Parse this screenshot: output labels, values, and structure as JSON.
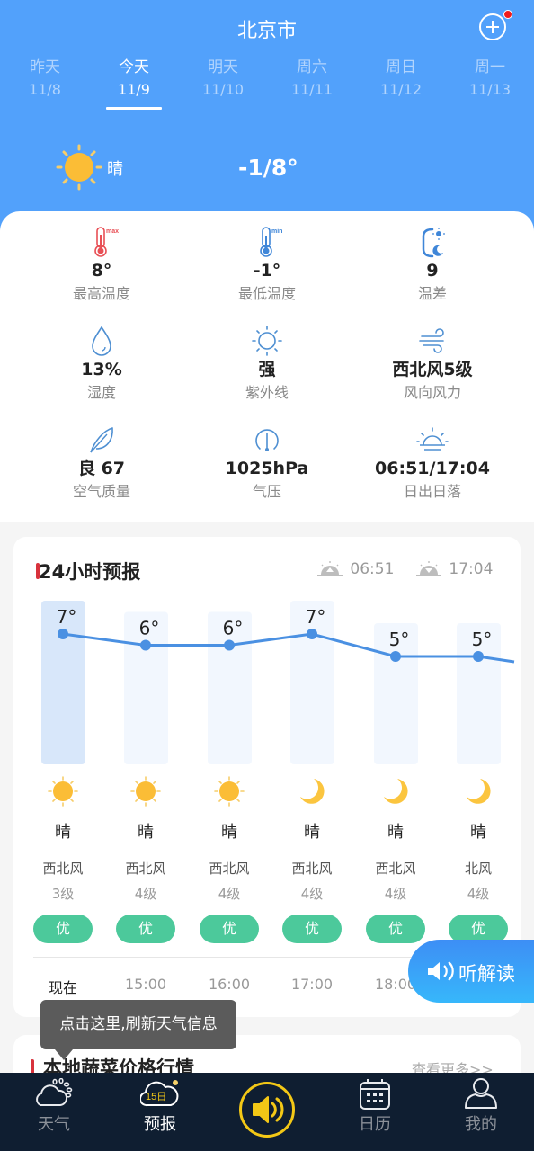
{
  "header": {
    "city": "北京市",
    "add_city_icon": "plus-circle-icon",
    "notification_dot": true,
    "colors": {
      "header_bg": "#52a1fb",
      "accent_red": "#d8323c",
      "aqi_good": "#4cc99b",
      "tabbar_bg": "#0f1e31",
      "tab_center": "#f3c816"
    }
  },
  "days": [
    {
      "name": "昨天",
      "date": "11/8",
      "active": false
    },
    {
      "name": "今天",
      "date": "11/9",
      "active": true
    },
    {
      "name": "明天",
      "date": "11/10",
      "active": false
    },
    {
      "name": "周六",
      "date": "11/11",
      "active": false
    },
    {
      "name": "周日",
      "date": "11/12",
      "active": false
    },
    {
      "name": "周一",
      "date": "11/13",
      "active": false
    }
  ],
  "current": {
    "icon": "sun-icon",
    "condition": "晴",
    "temp_range": "-1/8°"
  },
  "details": [
    {
      "icon": "thermometer-max-icon",
      "value": "8°",
      "label": "最高温度"
    },
    {
      "icon": "thermometer-min-icon",
      "value": "-1°",
      "label": "最低温度"
    },
    {
      "icon": "temp-diff-icon",
      "value": "9",
      "label": "温差"
    },
    {
      "icon": "humidity-drop-icon",
      "value": "13%",
      "label": "湿度"
    },
    {
      "icon": "uv-sun-icon",
      "value": "强",
      "label": "紫外线"
    },
    {
      "icon": "wind-icon",
      "value": "西北风5级",
      "label": "风向风力"
    },
    {
      "icon": "leaf-icon",
      "value": "良 67",
      "label": "空气质量"
    },
    {
      "icon": "pressure-gauge-icon",
      "value": "1025hPa",
      "label": "气压"
    },
    {
      "icon": "sunrise-icon",
      "value": "06:51/17:04",
      "label": "日出日落"
    }
  ],
  "hourly": {
    "title": "24小时预报",
    "sunrise": "06:51",
    "sunset": "17:04",
    "items": [
      {
        "time": "现在",
        "temp": 7,
        "temp_label": "7°",
        "icon": "sun-icon",
        "cond": "晴",
        "wind_dir": "西北风",
        "wind_level": "3级",
        "aqi": "优",
        "highlight": true
      },
      {
        "time": "15:00",
        "temp": 6,
        "temp_label": "6°",
        "icon": "sun-icon",
        "cond": "晴",
        "wind_dir": "西北风",
        "wind_level": "4级",
        "aqi": "优",
        "highlight": false
      },
      {
        "time": "16:00",
        "temp": 6,
        "temp_label": "6°",
        "icon": "sun-icon",
        "cond": "晴",
        "wind_dir": "西北风",
        "wind_level": "4级",
        "aqi": "优",
        "highlight": false
      },
      {
        "time": "17:00",
        "temp": 7,
        "temp_label": "7°",
        "icon": "moon-icon",
        "cond": "晴",
        "wind_dir": "西北风",
        "wind_level": "4级",
        "aqi": "优",
        "highlight": false
      },
      {
        "time": "18:00",
        "temp": 5,
        "temp_label": "5°",
        "icon": "moon-icon",
        "cond": "晴",
        "wind_dir": "西北风",
        "wind_level": "4级",
        "aqi": "优",
        "highlight": false
      },
      {
        "time": "",
        "temp": 5,
        "temp_label": "5°",
        "icon": "moon-icon",
        "cond": "晴",
        "wind_dir": "北风",
        "wind_level": "4级",
        "aqi": "优",
        "highlight": false
      }
    ]
  },
  "listen_button": {
    "label": "听解读",
    "icon": "speaker-icon"
  },
  "tooltip": {
    "text": "点击这里,刷新天气信息"
  },
  "market": {
    "title": "本地蔬菜价格行情",
    "more": "查看更多>>"
  },
  "tabbar": [
    {
      "label": "天气",
      "icon": "cloud-sun-icon",
      "active": false
    },
    {
      "label": "预报",
      "icon": "forecast-15day-icon",
      "badge": "15日",
      "active": true
    },
    {
      "label": "",
      "icon": "speaker-icon",
      "active": false
    },
    {
      "label": "日历",
      "icon": "calendar-icon",
      "active": false
    },
    {
      "label": "我的",
      "icon": "user-icon",
      "active": false
    }
  ]
}
